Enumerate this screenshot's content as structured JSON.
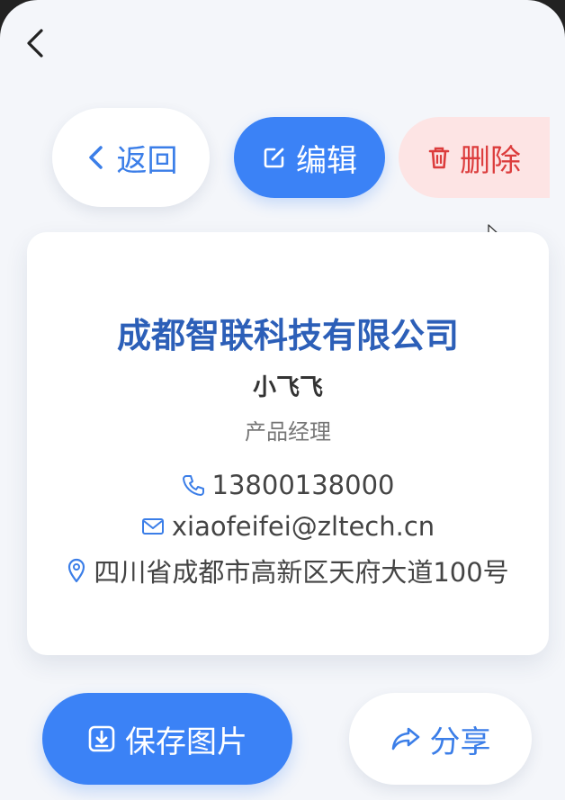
{
  "nav": {
    "back_icon": "chevron-left-icon"
  },
  "actions": {
    "back_label": "返回",
    "edit_label": "编辑",
    "delete_label": "删除"
  },
  "card": {
    "company": "成都智联科技有限公司",
    "name": "小飞飞",
    "title": "产品经理",
    "phone": "13800138000",
    "email": "xiaofeifei@zltech.cn",
    "address": "四川省成都市高新区天府大道100号"
  },
  "footer": {
    "save_label": "保存图片",
    "share_label": "分享"
  },
  "colors": {
    "primary": "#3b82f6",
    "danger": "#dc3c3c",
    "danger_bg": "#fde4e4",
    "company_text": "#2c5fb8",
    "background": "#f4f6fa"
  }
}
